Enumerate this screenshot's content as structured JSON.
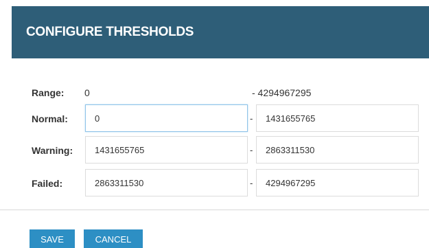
{
  "dialog": {
    "title": "CONFIGURE THRESHOLDS"
  },
  "range": {
    "label": "Range:",
    "min": "0",
    "max": "- 4294967295"
  },
  "rows": [
    {
      "label": "Normal:",
      "from": "0",
      "separator": "-",
      "to": "1431655765"
    },
    {
      "label": "Warning:",
      "from": "1431655765",
      "separator": "-",
      "to": "2863311530"
    },
    {
      "label": "Failed:",
      "from": "2863311530",
      "separator": "-",
      "to": "4294967295"
    }
  ],
  "buttons": {
    "save_label": "SAVE",
    "cancel_label": "CANCEL"
  },
  "colors": {
    "header_bg": "#2e5e78",
    "button_bg": "#2d8fc4",
    "focus_border": "#8ec3e8"
  }
}
